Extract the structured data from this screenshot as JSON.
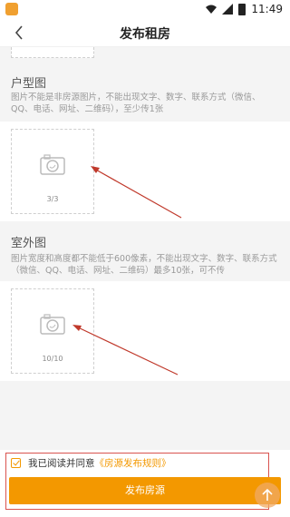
{
  "status_bar": {
    "time": "11:49"
  },
  "header": {
    "title": "发布租房"
  },
  "floor_plan": {
    "title": "户型图",
    "description": "图片不能是非房源图片，不能出现文字、数字、联系方式（微信、QQ、电话、网址、二维码），至少传1张",
    "count": "3/3"
  },
  "exterior": {
    "title": "室外图",
    "description": "图片宽度和高度都不能低于600像素，不能出现文字、数字、联系方式（微信、QQ、电话、网址、二维码）最多10张，可不传",
    "count": "10/10"
  },
  "agreement": {
    "text": "我已阅读并同意",
    "rule_link": "《房源发布规则》",
    "checked": true
  },
  "publish_button": {
    "label": "发布房源"
  },
  "colors": {
    "accent": "#f39800",
    "annotation_red": "#d9534f"
  }
}
